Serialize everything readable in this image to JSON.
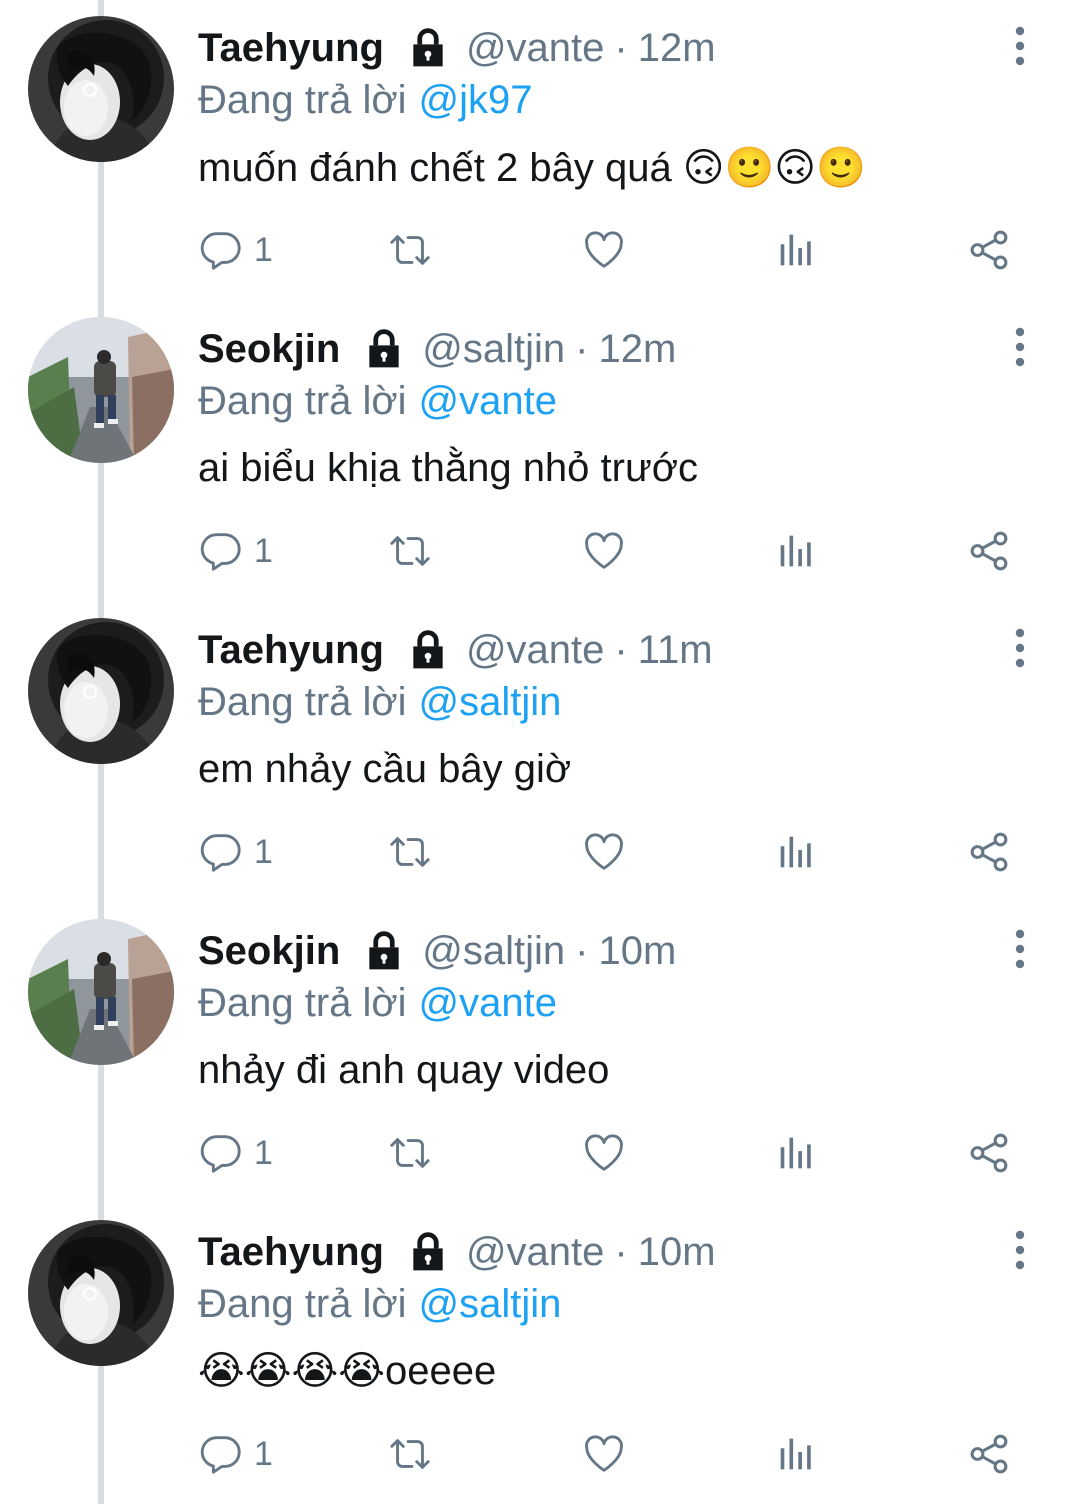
{
  "tweets": [
    {
      "name": "Taehyung",
      "handle": "@vante",
      "separator": "·",
      "time": "12m",
      "replying_label": "Đang trả lời",
      "replying_to": "@jk97",
      "text": "muốn đánh chết 2 bây quá 🙃🙂🙃🙂",
      "reply_count": "1",
      "avatar": "bw-portrait"
    },
    {
      "name": "Seokjin",
      "handle": "@saltjin",
      "separator": "·",
      "time": "12m",
      "replying_label": "Đang trả lời",
      "replying_to": "@vante",
      "text": "ai biểu khịa thằng nhỏ trước",
      "reply_count": "1",
      "avatar": "street-walk"
    },
    {
      "name": "Taehyung",
      "handle": "@vante",
      "separator": "·",
      "time": "11m",
      "replying_label": "Đang trả lời",
      "replying_to": "@saltjin",
      "text": "em nhảy cầu bây giờ",
      "reply_count": "1",
      "avatar": "bw-portrait"
    },
    {
      "name": "Seokjin",
      "handle": "@saltjin",
      "separator": "·",
      "time": "10m",
      "replying_label": "Đang trả lời",
      "replying_to": "@vante",
      "text": "nhảy đi anh quay video",
      "reply_count": "1",
      "avatar": "street-walk"
    },
    {
      "name": "Taehyung",
      "handle": "@vante",
      "separator": "·",
      "time": "10m",
      "replying_label": "Đang trả lời",
      "replying_to": "@saltjin",
      "text": "😭😭😭😭oeeee",
      "reply_count": "1",
      "avatar": "bw-portrait"
    }
  ],
  "icons": {
    "lock": "lock-icon",
    "more": "more-vertical-icon",
    "reply": "reply-icon",
    "retweet": "retweet-icon",
    "like": "heart-icon",
    "stats": "analytics-icon",
    "share": "share-icon"
  },
  "colors": {
    "text": "#14171a",
    "secondary": "#657786",
    "link": "#1da1f2",
    "thread_line": "#d8dde1"
  }
}
